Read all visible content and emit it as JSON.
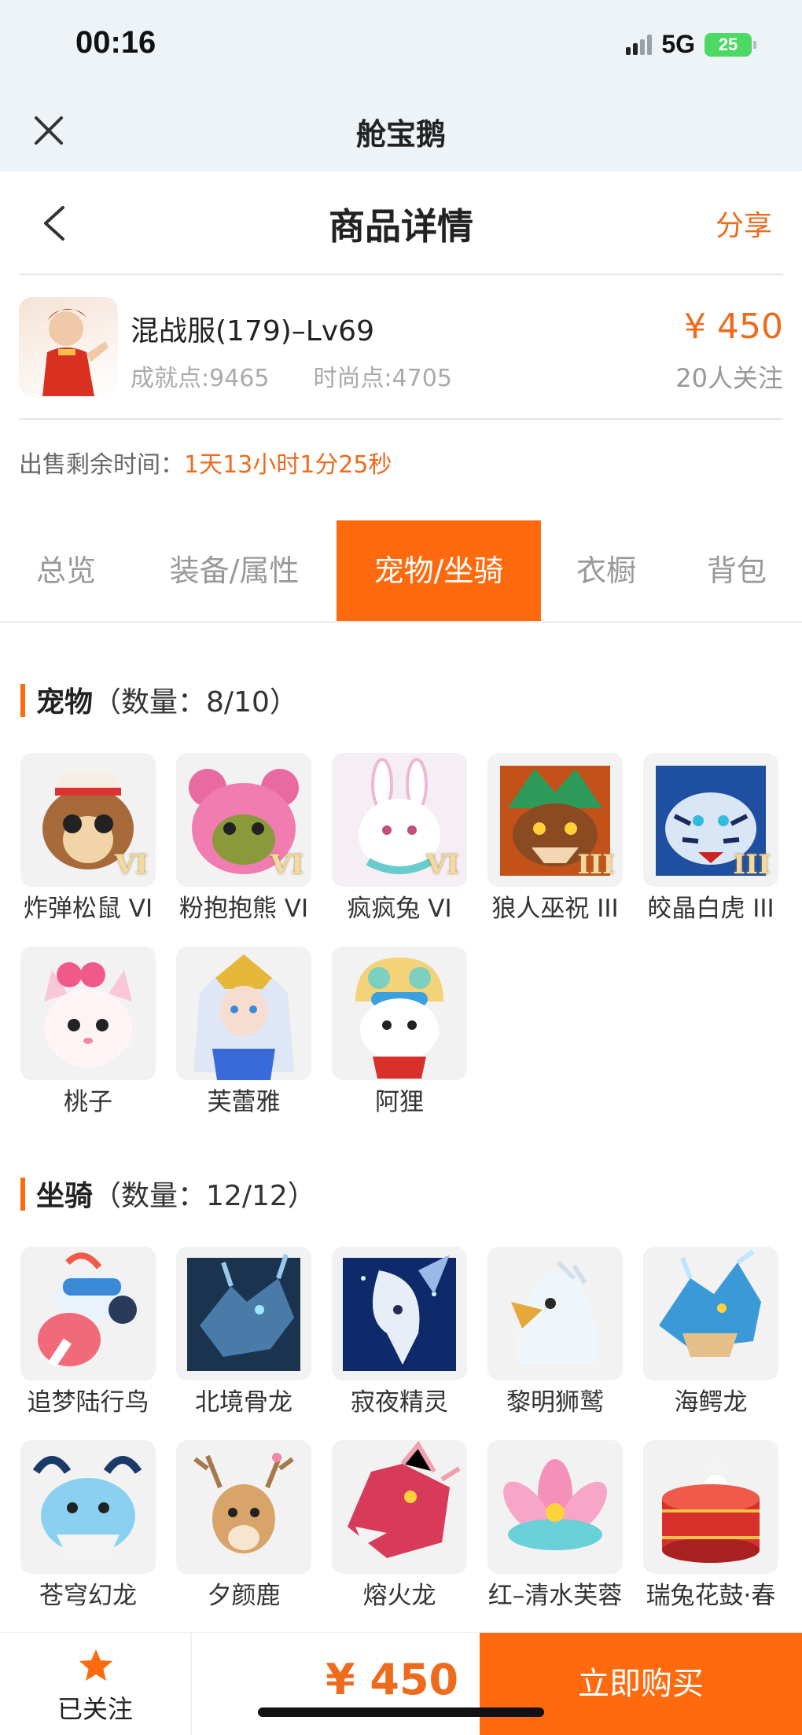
{
  "status": {
    "time": "00:16",
    "network": "5G",
    "battery": "25"
  },
  "appbar": {
    "title": "舱宝鹅"
  },
  "navbar": {
    "title": "商品详情",
    "share": "分享"
  },
  "product": {
    "name": "混战服(179)–Lv69",
    "achievement": "成就点:9465",
    "fashion": "时尚点:4705",
    "price": "¥ 450",
    "followers": "20人关注"
  },
  "sale": {
    "label": "出售剩余时间：",
    "remaining": "1天13小时1分25秒"
  },
  "tabs": [
    {
      "label": "总览"
    },
    {
      "label": "装备/属性"
    },
    {
      "label": "宠物/坐骑"
    },
    {
      "label": "衣橱"
    },
    {
      "label": "背包"
    }
  ],
  "pets": {
    "title": "宠物",
    "count": "（数量：8/10）",
    "items": [
      {
        "label": "炸弹松鼠 VI",
        "badge": "VI"
      },
      {
        "label": "粉抱抱熊 VI",
        "badge": "VI"
      },
      {
        "label": "疯疯兔 VI",
        "badge": "VI"
      },
      {
        "label": "狼人巫祝 III",
        "badge": "III"
      },
      {
        "label": "皎晶白虎 III",
        "badge": "III"
      },
      {
        "label": "桃子",
        "badge": ""
      },
      {
        "label": "芙蕾雅",
        "badge": ""
      },
      {
        "label": "阿狸",
        "badge": ""
      }
    ]
  },
  "mounts": {
    "title": "坐骑",
    "count": "（数量：12/12）",
    "items": [
      {
        "label": "追梦陆行鸟"
      },
      {
        "label": "北境骨龙"
      },
      {
        "label": "寂夜精灵"
      },
      {
        "label": "黎明狮鹫"
      },
      {
        "label": "海鳄龙"
      },
      {
        "label": "苍穹幻龙"
      },
      {
        "label": "夕颜鹿"
      },
      {
        "label": "熔火龙"
      },
      {
        "label": "红–清水芙蓉"
      },
      {
        "label": "瑞兔花鼓·春"
      }
    ]
  },
  "bottom": {
    "fav_label": "已关注",
    "price": "¥ 450",
    "buy_label": "立即购买"
  },
  "colors": {
    "accent": "#ff6a0e",
    "price": "#ee6a1d",
    "header_bg": "#eef3f7"
  }
}
